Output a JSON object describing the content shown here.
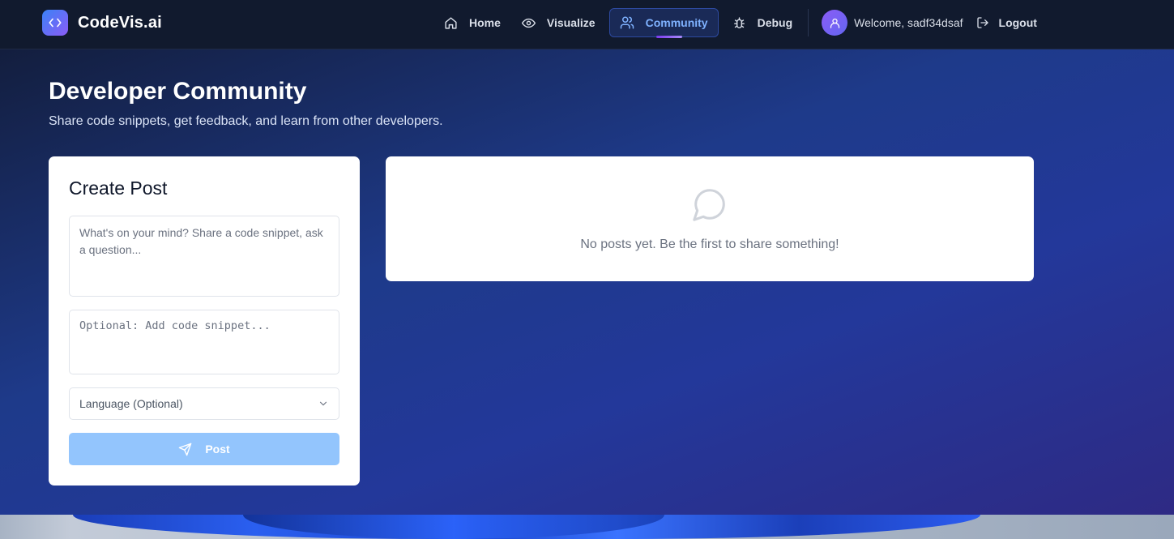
{
  "brand": {
    "name": "CodeVis.ai",
    "logo_icon": "code-brackets-icon"
  },
  "nav": {
    "items": [
      {
        "label": "Home",
        "icon": "home-icon",
        "active": false
      },
      {
        "label": "Visualize",
        "icon": "eye-icon",
        "active": false
      },
      {
        "label": "Community",
        "icon": "users-icon",
        "active": true
      },
      {
        "label": "Debug",
        "icon": "bug-icon",
        "active": false
      }
    ],
    "welcome": "Welcome, sadf34dsaf",
    "logout": "Logout"
  },
  "page": {
    "title": "Developer Community",
    "subtitle": "Share code snippets, get feedback, and learn from other developers."
  },
  "create_post": {
    "title": "Create Post",
    "message_placeholder": "What's on your mind? Share a code snippet, ask a question...",
    "code_placeholder": "Optional: Add code snippet...",
    "language_selected": "Language (Optional)",
    "post_label": "Post"
  },
  "feed": {
    "empty_text": "No posts yet. Be the first to share something!"
  },
  "colors": {
    "accent": "#7fb2ff",
    "post_button": "#93c5fd",
    "brand_gradient_start": "#3b82f6",
    "brand_gradient_end": "#8b5cf6"
  }
}
